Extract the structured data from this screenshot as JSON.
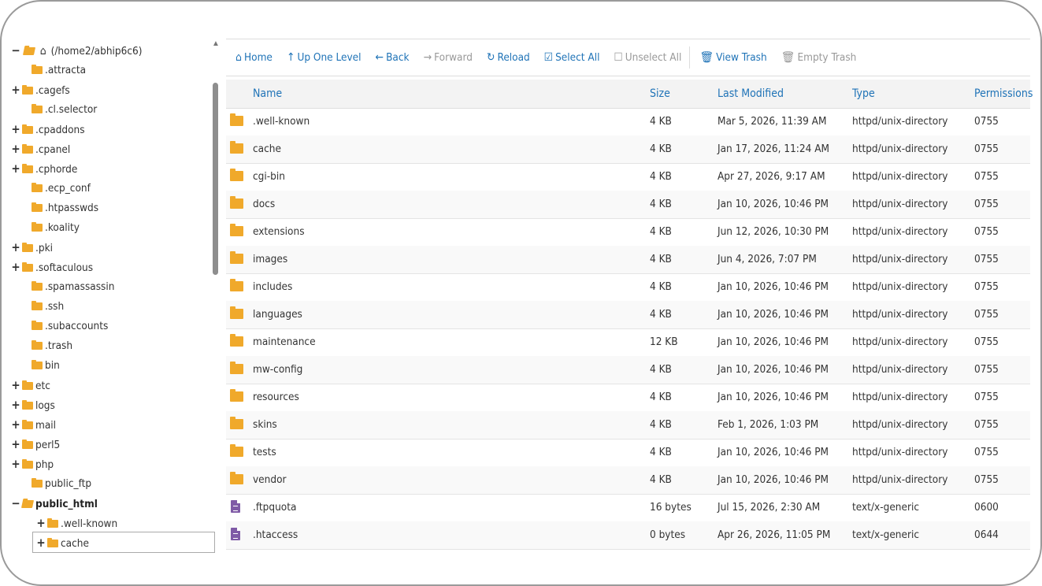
{
  "tree": {
    "root_label": "(/home2/abhip6c6)",
    "items": [
      {
        "label": ".attracta",
        "expander": ""
      },
      {
        "label": ".cagefs",
        "expander": "+"
      },
      {
        "label": ".cl.selector",
        "expander": ""
      },
      {
        "label": ".cpaddons",
        "expander": "+"
      },
      {
        "label": ".cpanel",
        "expander": "+"
      },
      {
        "label": ".cphorde",
        "expander": "+"
      },
      {
        "label": ".ecp_conf",
        "expander": ""
      },
      {
        "label": ".htpasswds",
        "expander": ""
      },
      {
        "label": ".koality",
        "expander": ""
      },
      {
        "label": ".pki",
        "expander": "+"
      },
      {
        "label": ".softaculous",
        "expander": "+"
      },
      {
        "label": ".spamassassin",
        "expander": ""
      },
      {
        "label": ".ssh",
        "expander": ""
      },
      {
        "label": ".subaccounts",
        "expander": ""
      },
      {
        "label": ".trash",
        "expander": ""
      },
      {
        "label": "bin",
        "expander": ""
      },
      {
        "label": "etc",
        "expander": "+"
      },
      {
        "label": "logs",
        "expander": "+"
      },
      {
        "label": "mail",
        "expander": "+"
      },
      {
        "label": "perl5",
        "expander": "+"
      },
      {
        "label": "php",
        "expander": "+"
      },
      {
        "label": "public_ftp",
        "expander": ""
      },
      {
        "label": "public_html",
        "expander": "−"
      }
    ],
    "children": [
      {
        "label": ".well-known",
        "expander": "+"
      },
      {
        "label": "cache",
        "expander": "+"
      }
    ]
  },
  "toolbar": {
    "home": "Home",
    "up": "Up One Level",
    "back": "Back",
    "forward": "Forward",
    "reload": "Reload",
    "select_all": "Select All",
    "unselect_all": "Unselect All",
    "view_trash": "View Trash",
    "empty_trash": "Empty Trash"
  },
  "columns": {
    "name": "Name",
    "size": "Size",
    "modified": "Last Modified",
    "type": "Type",
    "permissions": "Permissions"
  },
  "files": [
    {
      "name": ".well-known",
      "size": "4 KB",
      "modified": "Mar 5, 2026, 11:39 AM",
      "type": "httpd/unix-directory",
      "perm": "0755",
      "kind": "folder"
    },
    {
      "name": "cache",
      "size": "4 KB",
      "modified": "Jan 17, 2026, 11:24 AM",
      "type": "httpd/unix-directory",
      "perm": "0755",
      "kind": "folder"
    },
    {
      "name": "cgi-bin",
      "size": "4 KB",
      "modified": "Apr 27, 2026, 9:17 AM",
      "type": "httpd/unix-directory",
      "perm": "0755",
      "kind": "folder"
    },
    {
      "name": "docs",
      "size": "4 KB",
      "modified": "Jan 10, 2026, 10:46 PM",
      "type": "httpd/unix-directory",
      "perm": "0755",
      "kind": "folder"
    },
    {
      "name": "extensions",
      "size": "4 KB",
      "modified": "Jun 12, 2026, 10:30 PM",
      "type": "httpd/unix-directory",
      "perm": "0755",
      "kind": "folder"
    },
    {
      "name": "images",
      "size": "4 KB",
      "modified": "Jun 4, 2026, 7:07 PM",
      "type": "httpd/unix-directory",
      "perm": "0755",
      "kind": "folder"
    },
    {
      "name": "includes",
      "size": "4 KB",
      "modified": "Jan 10, 2026, 10:46 PM",
      "type": "httpd/unix-directory",
      "perm": "0755",
      "kind": "folder"
    },
    {
      "name": "languages",
      "size": "4 KB",
      "modified": "Jan 10, 2026, 10:46 PM",
      "type": "httpd/unix-directory",
      "perm": "0755",
      "kind": "folder"
    },
    {
      "name": "maintenance",
      "size": "12 KB",
      "modified": "Jan 10, 2026, 10:46 PM",
      "type": "httpd/unix-directory",
      "perm": "0755",
      "kind": "folder"
    },
    {
      "name": "mw-config",
      "size": "4 KB",
      "modified": "Jan 10, 2026, 10:46 PM",
      "type": "httpd/unix-directory",
      "perm": "0755",
      "kind": "folder"
    },
    {
      "name": "resources",
      "size": "4 KB",
      "modified": "Jan 10, 2026, 10:46 PM",
      "type": "httpd/unix-directory",
      "perm": "0755",
      "kind": "folder"
    },
    {
      "name": "skins",
      "size": "4 KB",
      "modified": "Feb 1, 2026, 1:03 PM",
      "type": "httpd/unix-directory",
      "perm": "0755",
      "kind": "folder"
    },
    {
      "name": "tests",
      "size": "4 KB",
      "modified": "Jan 10, 2026, 10:46 PM",
      "type": "httpd/unix-directory",
      "perm": "0755",
      "kind": "folder"
    },
    {
      "name": "vendor",
      "size": "4 KB",
      "modified": "Jan 10, 2026, 10:46 PM",
      "type": "httpd/unix-directory",
      "perm": "0755",
      "kind": "folder"
    },
    {
      "name": ".ftpquota",
      "size": "16 bytes",
      "modified": "Jul 15, 2026, 2:30 AM",
      "type": "text/x-generic",
      "perm": "0600",
      "kind": "file"
    },
    {
      "name": ".htaccess",
      "size": "0 bytes",
      "modified": "Apr 26, 2026, 11:05 PM",
      "type": "text/x-generic",
      "perm": "0644",
      "kind": "file"
    }
  ],
  "colors": {
    "link": "#1f73b7",
    "folder": "#f0a92b",
    "file": "#7f5aa6"
  }
}
